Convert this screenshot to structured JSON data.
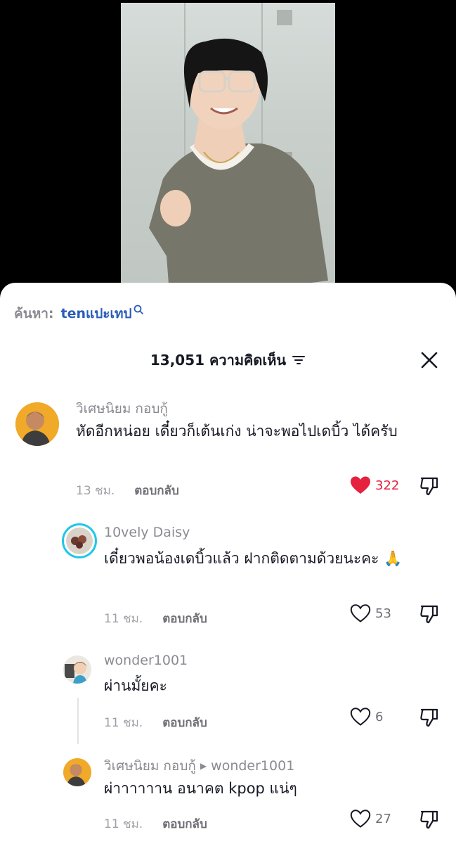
{
  "search": {
    "prefix": "ค้นหา:",
    "term": "tenแปะเทป"
  },
  "header": {
    "count_label": "13,051 ความคิดเห็น"
  },
  "comments": [
    {
      "author": "วิเศษนิยม กอบกู้",
      "text": "หัดอีกหน่อย เดี๋ยวก็เต้นเก่ง น่าจะพอไปเดบิ้ว ได้ครับ",
      "time": "13 ชม.",
      "reply": "ตอบกลับ",
      "likes": "322",
      "liked": true
    },
    {
      "author": "10vely Daisy",
      "text": "เดี๋ยวพอน้องเดบิ้วแล้ว ฝากติดตามด้วยนะคะ 🙏",
      "time": "11 ชม.",
      "reply": "ตอบกลับ",
      "likes": "53",
      "liked": false
    },
    {
      "author": "wonder1001",
      "text": "ผ่านมั้ยคะ",
      "time": "11 ชม.",
      "reply": "ตอบกลับ",
      "likes": "6",
      "liked": false
    },
    {
      "author": "วิเศษนิยม กอบกู้",
      "reply_to": "wonder1001",
      "text": "ผ่าาาาาาน อนาคต kpop แน่ๆ",
      "time": "11 ชม.",
      "reply": "ตอบกลับ",
      "likes": "27",
      "liked": false
    }
  ],
  "colors": {
    "accent_link": "#2b5db9",
    "like_red": "#e5213f",
    "story_ring": "#20c7e8"
  }
}
